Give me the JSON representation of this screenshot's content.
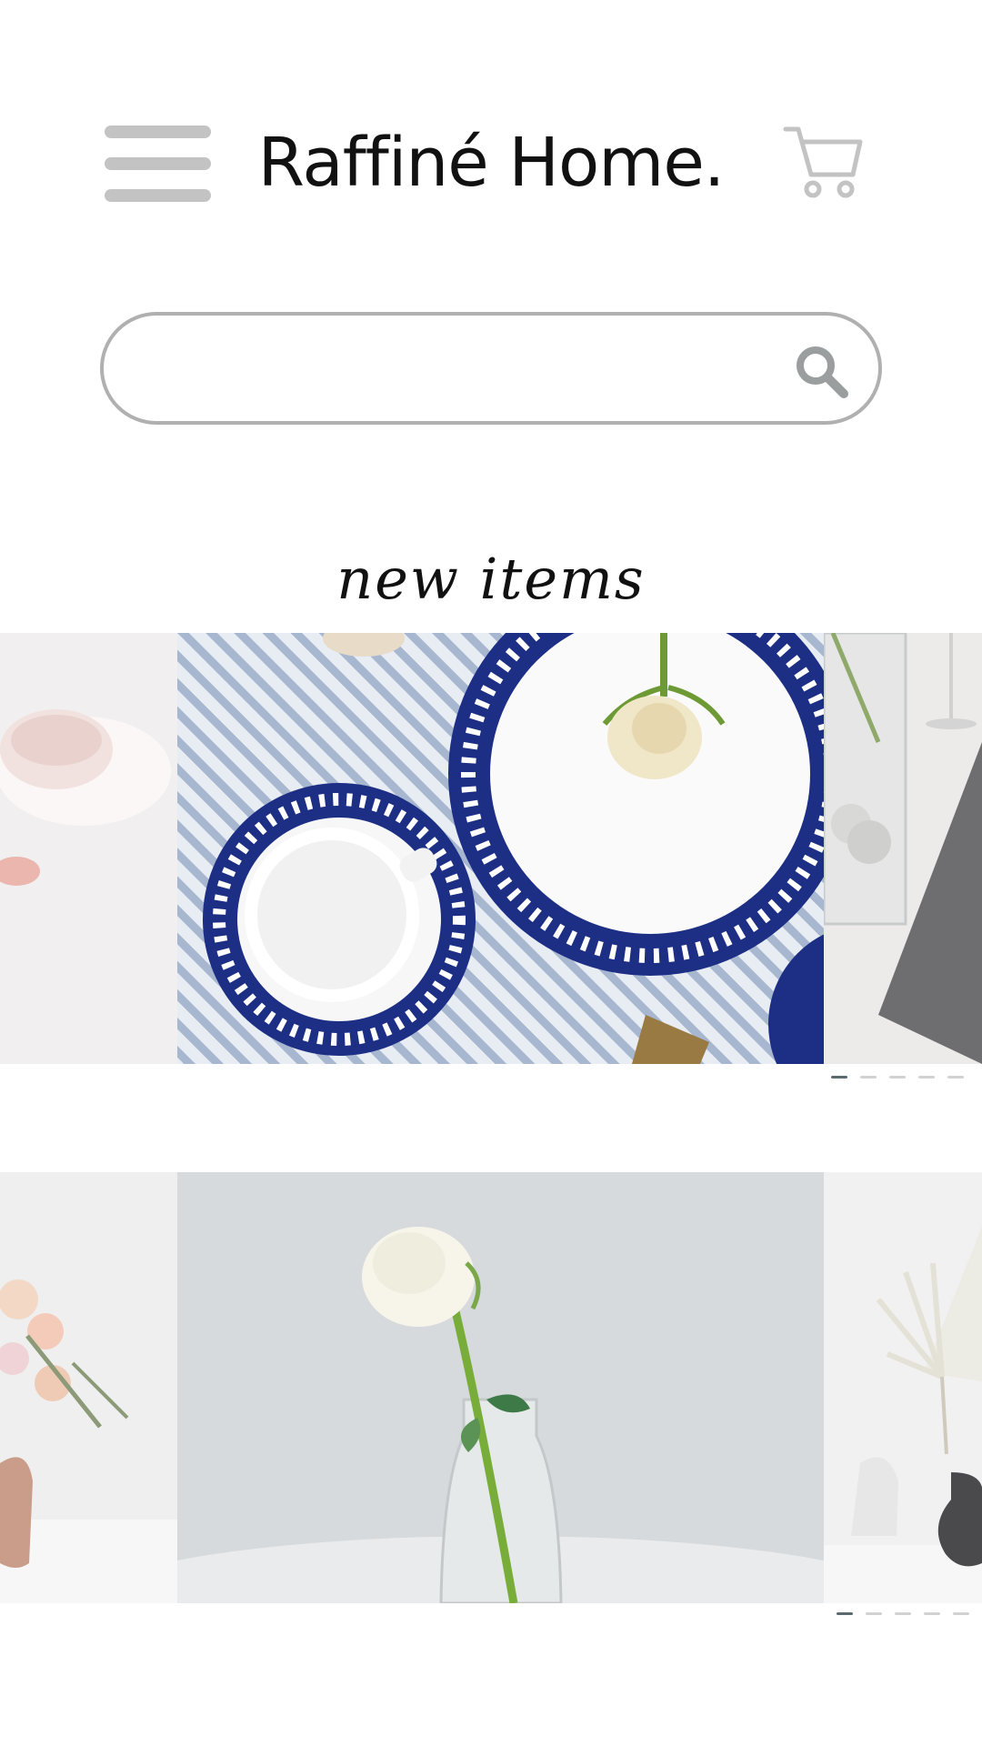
{
  "header": {
    "brand": "Raffiné Home.",
    "menu_icon": "hamburger-menu-icon",
    "cart_icon": "shopping-cart-icon"
  },
  "search": {
    "value": "",
    "placeholder": "",
    "icon": "search-icon"
  },
  "section": {
    "title": "new items"
  },
  "carousels": [
    {
      "slides": [
        "pink-ceramic-bowl-photo",
        "blue-dinnerware-with-rose-photo",
        "glass-vase-and-napkin-photo"
      ],
      "active_index": 0,
      "dot_count": 5
    },
    {
      "slides": [
        "pink-flower-bouquet-photo",
        "white-rose-in-glass-vase-photo",
        "dried-palm-in-black-vase-photo"
      ],
      "active_index": 0,
      "dot_count": 5
    }
  ],
  "colors": {
    "icon_gray": "#c3c3c3",
    "search_border": "#b0b0b0",
    "dot_active": "#5a6a6e",
    "dot_inactive": "#d2d2d2",
    "text": "#111111"
  }
}
